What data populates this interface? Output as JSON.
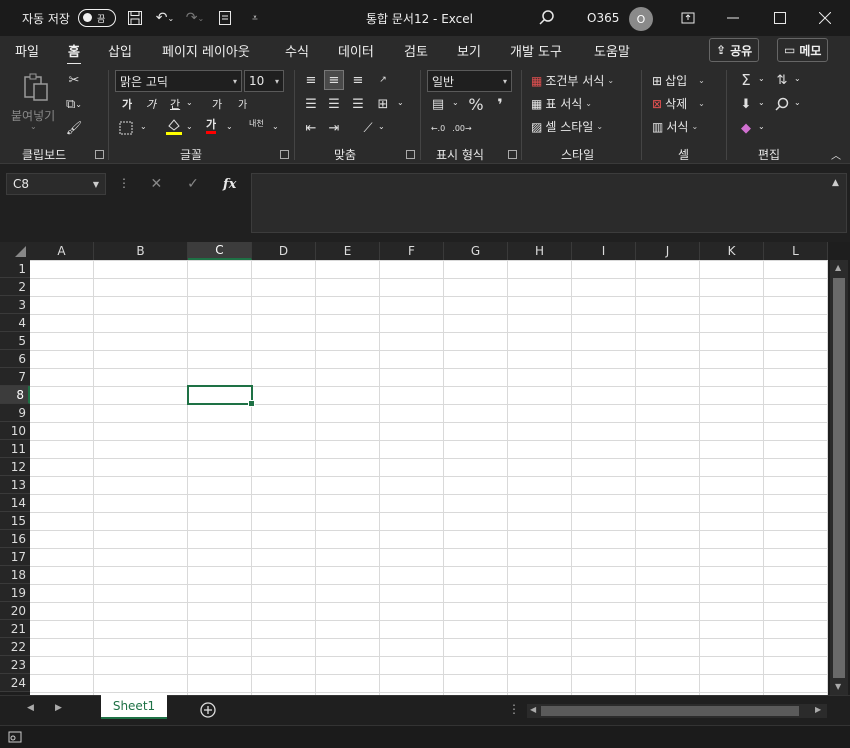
{
  "titlebar": {
    "autosave_label": "자동 저장",
    "toggle_text": "끔",
    "document_title": "통합 문서12  -  Excel",
    "user_name": "O365",
    "avatar_initial": "O"
  },
  "menu": {
    "tabs": [
      "파일",
      "홈",
      "삽입",
      "페이지 레이아웃",
      "수식",
      "데이터",
      "검토",
      "보기",
      "개발 도구",
      "도움말"
    ],
    "active_tab": "홈",
    "share_label": "공유",
    "memo_label": "메모"
  },
  "ribbon": {
    "clipboard": {
      "paste_label": "붙여넣기",
      "group_label": "클립보드"
    },
    "font": {
      "font_name": "맑은 고딕",
      "font_size": "10",
      "group_label": "글꼴",
      "bold": "가",
      "italic": "가",
      "underline": "간",
      "grow": "가",
      "shrink": "가",
      "font_color": "가",
      "phonetic": "내천"
    },
    "alignment": {
      "group_label": "맞춤"
    },
    "number": {
      "format": "일반",
      "group_label": "표시 형식"
    },
    "styles": {
      "conditional": "조건부 서식",
      "table": "표 서식",
      "cell_styles": "셀 스타일",
      "group_label": "스타일"
    },
    "cells": {
      "insert": "삽입",
      "delete": "삭제",
      "format": "서식",
      "group_label": "셀"
    },
    "editing": {
      "group_label": "편집"
    }
  },
  "formula_bar": {
    "name_box": "C8",
    "fx": "fx",
    "value": ""
  },
  "grid": {
    "columns": [
      "A",
      "B",
      "C",
      "D",
      "E",
      "F",
      "G",
      "H",
      "I",
      "J",
      "K",
      "L"
    ],
    "rows": [
      "1",
      "2",
      "3",
      "4",
      "5",
      "6",
      "7",
      "8",
      "9",
      "10",
      "11",
      "12",
      "13",
      "14",
      "15",
      "16",
      "17",
      "18",
      "19",
      "20",
      "21",
      "22",
      "23",
      "24"
    ],
    "selected_column": "C",
    "selected_row": "8"
  },
  "sheets": {
    "tabs": [
      "Sheet1"
    ],
    "active": "Sheet1"
  },
  "colors": {
    "accent": "#1e7145",
    "background": "#1e1e1e",
    "ribbon": "#2b2b2b"
  }
}
